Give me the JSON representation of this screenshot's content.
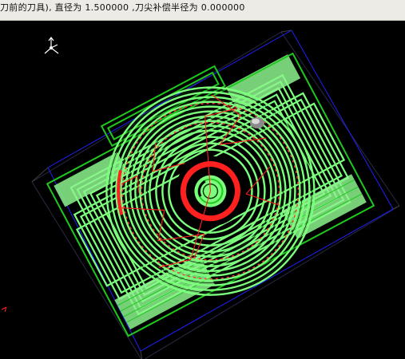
{
  "status_bar": {
    "message": "刀前的刀具), 直径为 1.500000 ,刀尖补偿半径为 0.000000"
  },
  "viewport": {
    "background_color": "#000000",
    "bounding_box_color": "#2020ff",
    "toolpath_colors": {
      "cut": "#7cff7c",
      "rapid": "#ff2020",
      "frame": "#1ec81e"
    },
    "icons": {
      "axis_triad_top_left": "xyz-axis-triad-icon",
      "axis_marker_bottom_left": "axis-marker-icon",
      "tool": "cutting-tool-icon"
    }
  }
}
